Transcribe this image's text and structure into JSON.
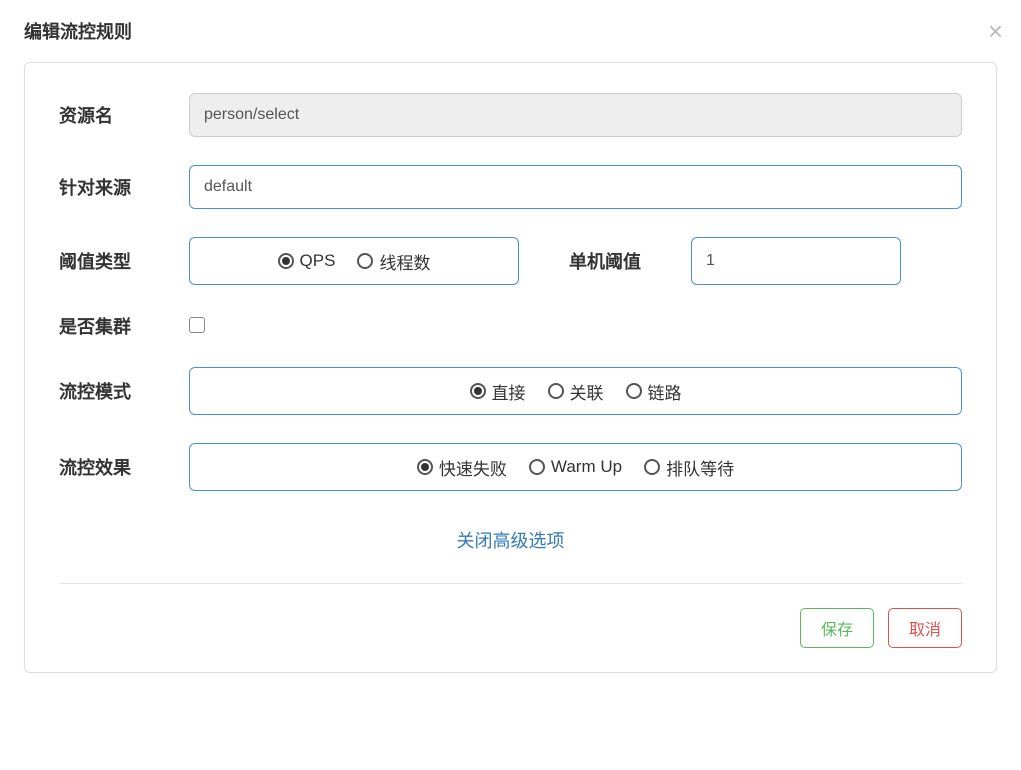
{
  "modal": {
    "title": "编辑流控规则",
    "close_icon": "×"
  },
  "form": {
    "resource": {
      "label": "资源名",
      "value": "person/select"
    },
    "source": {
      "label": "针对来源",
      "value": "default"
    },
    "threshold_type": {
      "label": "阈值类型",
      "options": [
        {
          "value": "qps",
          "label": "QPS",
          "selected": true
        },
        {
          "value": "thread",
          "label": "线程数",
          "selected": false
        }
      ]
    },
    "threshold_value": {
      "label": "单机阈值",
      "value": "1"
    },
    "cluster": {
      "label": "是否集群",
      "checked": false
    },
    "mode": {
      "label": "流控模式",
      "options": [
        {
          "value": "direct",
          "label": "直接",
          "selected": true
        },
        {
          "value": "relate",
          "label": "关联",
          "selected": false
        },
        {
          "value": "chain",
          "label": "链路",
          "selected": false
        }
      ]
    },
    "effect": {
      "label": "流控效果",
      "options": [
        {
          "value": "fail",
          "label": "快速失败",
          "selected": true
        },
        {
          "value": "warmup",
          "label": "Warm Up",
          "selected": false
        },
        {
          "value": "queue",
          "label": "排队等待",
          "selected": false
        }
      ]
    },
    "advanced_toggle": "关闭高级选项"
  },
  "footer": {
    "save": "保存",
    "cancel": "取消"
  }
}
